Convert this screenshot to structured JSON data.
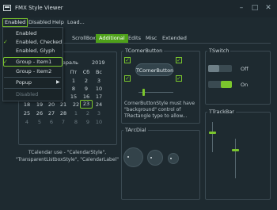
{
  "window": {
    "title": "FMX Style Viewer",
    "icons": {
      "app": "app-window-icon",
      "minimize": "minimize-icon",
      "maximize": "maximize-icon",
      "close": "close-icon"
    }
  },
  "menu": {
    "items": [
      "Enabled",
      "Disabled",
      "Help",
      "Load..."
    ]
  },
  "dropdown": {
    "items": [
      {
        "label": "Enabled",
        "checked": false
      },
      {
        "label": "Enabled, Checked",
        "checked": true
      },
      {
        "label": "Enabled, Glyph",
        "checked": false
      },
      {
        "label": "Group - Item1",
        "checked": true
      },
      {
        "label": "Group - Item2",
        "checked": false
      },
      {
        "label": "Popup",
        "submenu": true
      },
      {
        "label": "Disabled",
        "checked": false
      }
    ]
  },
  "tabs": [
    "ScrollBox",
    "Additional",
    "Edits",
    "Misc",
    "Extended"
  ],
  "active_tab": "Additional",
  "calendar": {
    "month_fragment": "враль",
    "year": "2019",
    "headers": [
      "Пт",
      "Сб",
      "Вс"
    ],
    "rows": [
      [
        "1",
        "2",
        "3"
      ],
      [
        "8",
        "9",
        "10"
      ],
      [
        "15",
        "16",
        "17"
      ],
      [
        "22",
        "23",
        "24"
      ],
      [
        "1",
        "2",
        "3"
      ]
    ],
    "visible_rows": [
      [
        "18",
        "19",
        "20",
        "21",
        "22",
        "23",
        "24"
      ],
      [
        "25",
        "26",
        "27",
        "28",
        "1",
        "2",
        "3"
      ],
      [
        "4",
        "5",
        "6",
        "7",
        "8",
        "9",
        "10"
      ]
    ],
    "today": "23",
    "caption": "TCalendar use - \"CalendarStyle\",\n\"TransparentListboxStyle\", \"CalendarLabel\""
  },
  "corner": {
    "group_label": "TCornerButton",
    "button_label": "TCornerButton",
    "note": "CornerButtonStyle must have\n\"background\" control of\nTRectangle type to allow..."
  },
  "switch": {
    "group_label": "TSwitch",
    "off_label": "Off",
    "on_label": "On",
    "state_on": true
  },
  "arcdial": {
    "group_label": "TArcDial"
  },
  "trackbar": {
    "group_label": "TTrackBar"
  },
  "colors": {
    "accent": "#7bc62d",
    "background": "#1e2a30",
    "tab_active": "#4ea01a"
  }
}
